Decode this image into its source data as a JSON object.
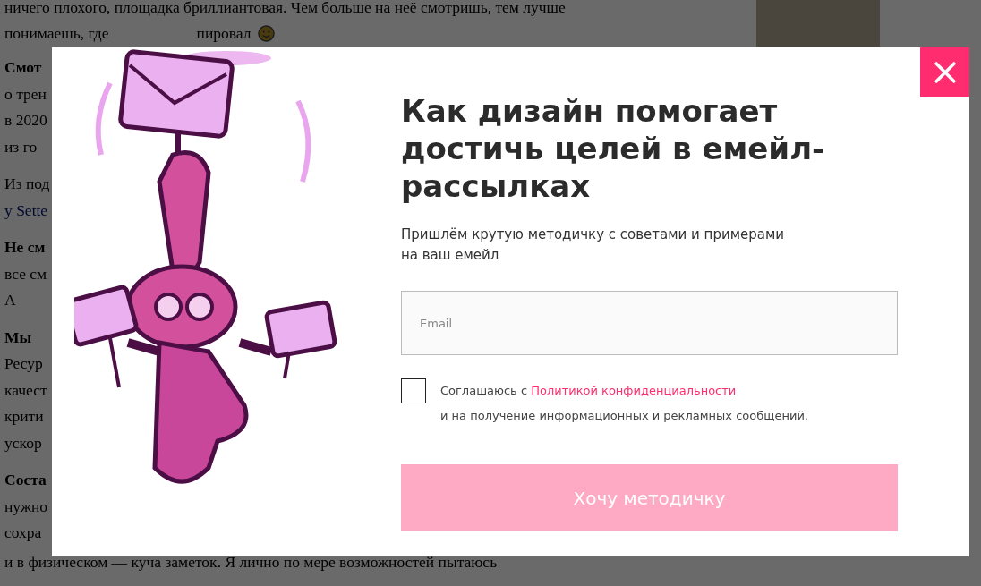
{
  "article": {
    "top_lines": [
      "ничего плохого, площадка бриллиантовая. Чем больше на неё смотришь, тем лучше",
      "понимаешь, где"
    ],
    "top_line_tail": "пировал",
    "left_paragraphs": [
      [
        {
          "text": "Смот",
          "kind": "bold"
        },
        {
          "text": "о трен",
          "kind": "plain"
        },
        {
          "text": "в 2020",
          "kind": "plain"
        },
        {
          "text": "из го",
          "kind": "plain"
        }
      ],
      [
        {
          "text": "Из под",
          "kind": "plain"
        },
        {
          "text": "у Sette",
          "kind": "link"
        }
      ],
      [
        {
          "text": "Не см",
          "kind": "bold"
        },
        {
          "text": "все см",
          "kind": "plain"
        },
        {
          "text": "А",
          "kind": "plain"
        }
      ],
      [
        {
          "text": "Мы",
          "kind": "bold"
        },
        {
          "text": "Ресур",
          "kind": "plain"
        },
        {
          "text": "качест",
          "kind": "plain"
        },
        {
          "text": "крити",
          "kind": "plain"
        },
        {
          "text": "ускор",
          "kind": "plain"
        }
      ],
      [
        {
          "text": "Соста",
          "kind": "bold"
        },
        {
          "text": "нужно",
          "kind": "plain"
        },
        {
          "text": "сохра",
          "kind": "plain"
        }
      ]
    ],
    "bottom_line": "и в физическом — куча заметок. Я лично по мере возможностей пытаюсь"
  },
  "popup": {
    "title": "Как дизайн помогает достичь целей в емейл-рассылках",
    "subtitle": "Пришлём крутую методичку с советами и примерами на ваш емейл",
    "email": {
      "placeholder": "Email"
    },
    "consent": {
      "checked": false,
      "text": "Соглашаюсь с ",
      "link": "Политикой конфиденциальности",
      "text_after": "и на получение информационных и рекламных сообщений."
    },
    "submit": "Хочу методичку"
  }
}
